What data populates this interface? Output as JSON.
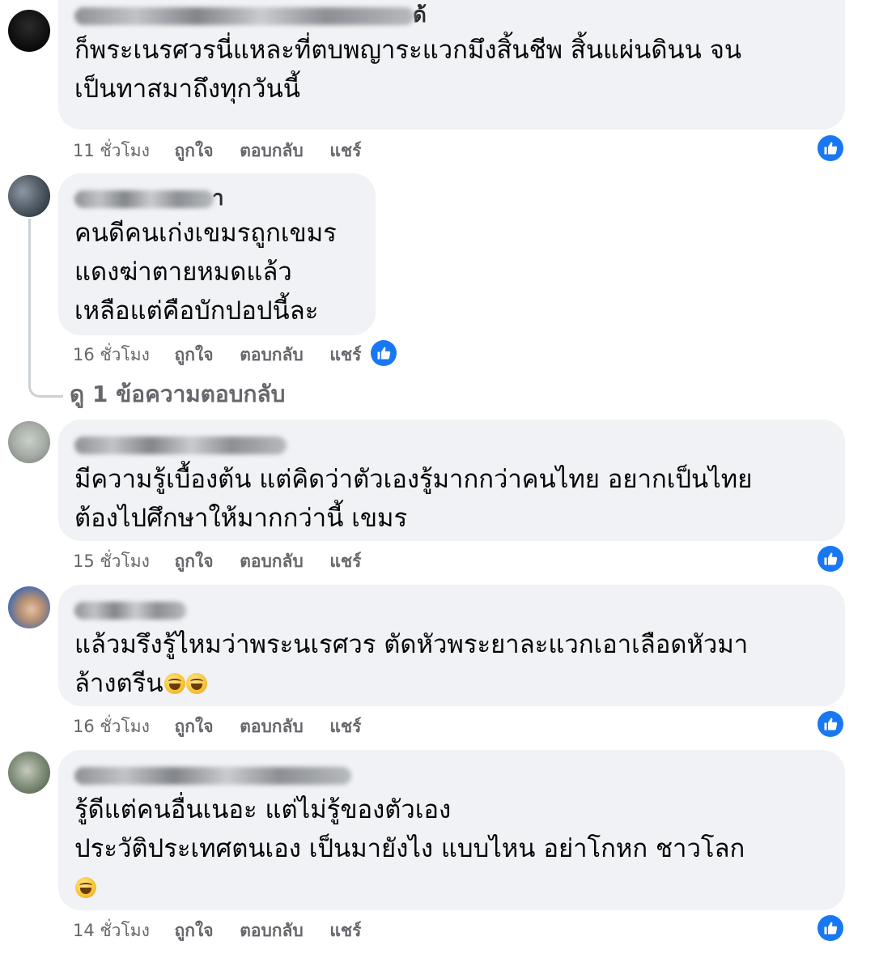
{
  "comments": [
    {
      "author_visible": "ด้",
      "lines": [
        "ก็พระเนรศวรนี่แหละที่ตบพญาระแวกมึงสิ้นชีพ สิ้นแผ่นดินน จน",
        "เป็นทาสมาถึงทุกวันนี้"
      ],
      "time": "11 ชั่วโมง",
      "like": "ถูกใจ",
      "reply": "ตอบกลับ",
      "share": "แชร์",
      "reaction_icon": "like-icon"
    },
    {
      "author_visible": "า",
      "lines": [
        "คนดีคนเก่งเขมรถูกเขมร",
        "แดงฆ่าตายหมดแล้ว",
        "เหลือแต่คือบักปอปนี้ละ"
      ],
      "time": "16 ชั่วโมง",
      "like": "ถูกใจ",
      "reply": "ตอบกลับ",
      "share": "แชร์",
      "reaction_icon": "like-icon"
    },
    {
      "author_visible": "",
      "lines": [
        "มีความรู้เบื้องต้น แต่คิดว่าตัวเองรู้มากกว่าคนไทย อยากเป็นไทย",
        "ต้องไปศึกษาให้มากกว่านี้ เขมร"
      ],
      "time": "15 ชั่วโมง",
      "like": "ถูกใจ",
      "reply": "ตอบกลับ",
      "share": "แชร์",
      "reaction_icon": "like-icon"
    },
    {
      "author_visible": "",
      "lines": [
        "แล้วมรึงรู้ไหมว่าพระนเรศวร ตัดหัวพระยาละแวกเอาเลือดหัวมา",
        "ล้างตรีน"
      ],
      "emoji_count": 2,
      "time": "16 ชั่วโมง",
      "like": "ถูกใจ",
      "reply": "ตอบกลับ",
      "share": "แชร์",
      "reaction_icon": "like-icon"
    },
    {
      "author_visible": "",
      "lines": [
        "รู้ดีแต่คนอื่นเนอะ แต่ไม่รู้ของตัวเอง",
        "ประวัติประเทศตนเอง เป็นมายังไง แบบไหน อย่าโกหก ชาวโลก"
      ],
      "emoji_line": true,
      "time": "14 ชั่วโมง",
      "like": "ถูกใจ",
      "reply": "ตอบกลับ",
      "share": "แชร์",
      "reaction_icon": "like-icon"
    }
  ],
  "view_replies": "ดู 1 ข้อความตอบกลับ",
  "colors": {
    "bubble": "#f0f2f5",
    "meta": "#65676b",
    "like_blue": "#1877f2",
    "text": "#050505"
  }
}
